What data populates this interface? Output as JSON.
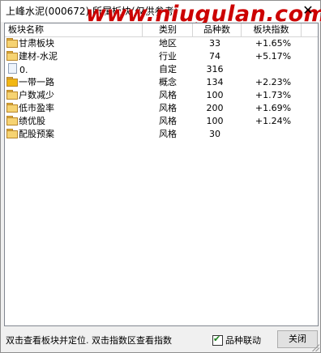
{
  "window": {
    "title": "上峰水泥(000672) 所属板块(仅供参考)",
    "watermark": "www.niugulan.com",
    "close_symbol": "✕"
  },
  "table": {
    "headers": {
      "name": "板块名称",
      "type": "类别",
      "count": "品种数",
      "index": "板块指数"
    },
    "rows": [
      {
        "name": "甘肃板块",
        "type": "地区",
        "count": "33",
        "index": "+1.65%",
        "icon": "folder-icon"
      },
      {
        "name": "建材-水泥",
        "type": "行业",
        "count": "74",
        "index": "+5.17%",
        "icon": "folder-icon"
      },
      {
        "name": "0.",
        "type": "自定",
        "count": "316",
        "index": "",
        "icon": "document-icon"
      },
      {
        "name": "一带一路",
        "type": "概念",
        "count": "134",
        "index": "+2.23%",
        "icon": "folder-icon"
      },
      {
        "name": "户数减少",
        "type": "风格",
        "count": "100",
        "index": "+1.73%",
        "icon": "folder-icon"
      },
      {
        "name": "低市盈率",
        "type": "风格",
        "count": "200",
        "index": "+1.69%",
        "icon": "folder-icon"
      },
      {
        "name": "绩优股",
        "type": "风格",
        "count": "100",
        "index": "+1.24%",
        "icon": "folder-icon"
      },
      {
        "name": "配股预案",
        "type": "风格",
        "count": "30",
        "index": "",
        "icon": "folder-icon"
      }
    ]
  },
  "footer": {
    "hint": "双击查看板块并定位. 双击指数区查看指数",
    "checkbox_label": "品种联动",
    "checkbox_checked": true,
    "close_button": "关闭"
  }
}
